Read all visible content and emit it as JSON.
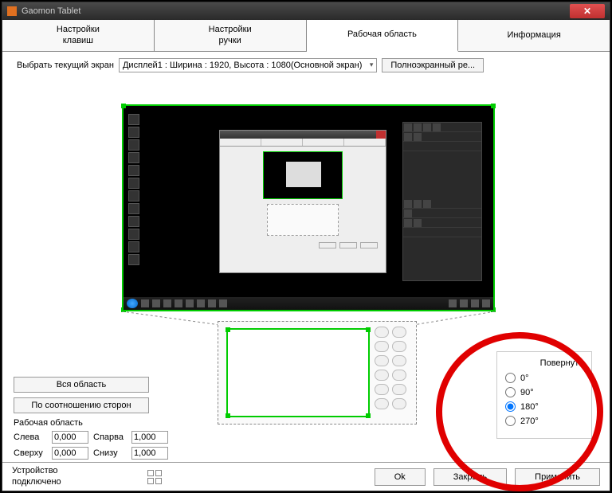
{
  "window": {
    "title": "Gaomon Tablet"
  },
  "tabs": {
    "keys": "Настройки\nклавиш",
    "pen": "Настройки\nручки",
    "workarea": "Рабочая область",
    "info": "Информация"
  },
  "screen": {
    "label": "Выбрать текущий экран",
    "selected": "Дисплей1 : Ширина : 1920, Высота : 1080(Основной экран)",
    "fullscreen_btn": "Полноэкранный ре..."
  },
  "buttons": {
    "whole_area": "Вся область",
    "aspect": "По соотношению сторон"
  },
  "workarea_label": "Рабочая область",
  "coords": {
    "left_label": "Слева",
    "left": "0,000",
    "right_label": "Спарва",
    "right": "1,000",
    "top_label": "Сверху",
    "top": "0,000",
    "bottom_label": "Снизу",
    "bottom": "1,000"
  },
  "rotate": {
    "title": "Повернуть",
    "opt0": "0°",
    "opt90": "90°",
    "opt180": "180°",
    "opt270": "270°",
    "selected": "180"
  },
  "footer": {
    "status": "Устройство\nподключено",
    "ok": "Ok",
    "close": "Закрыть",
    "apply": "Применить"
  }
}
